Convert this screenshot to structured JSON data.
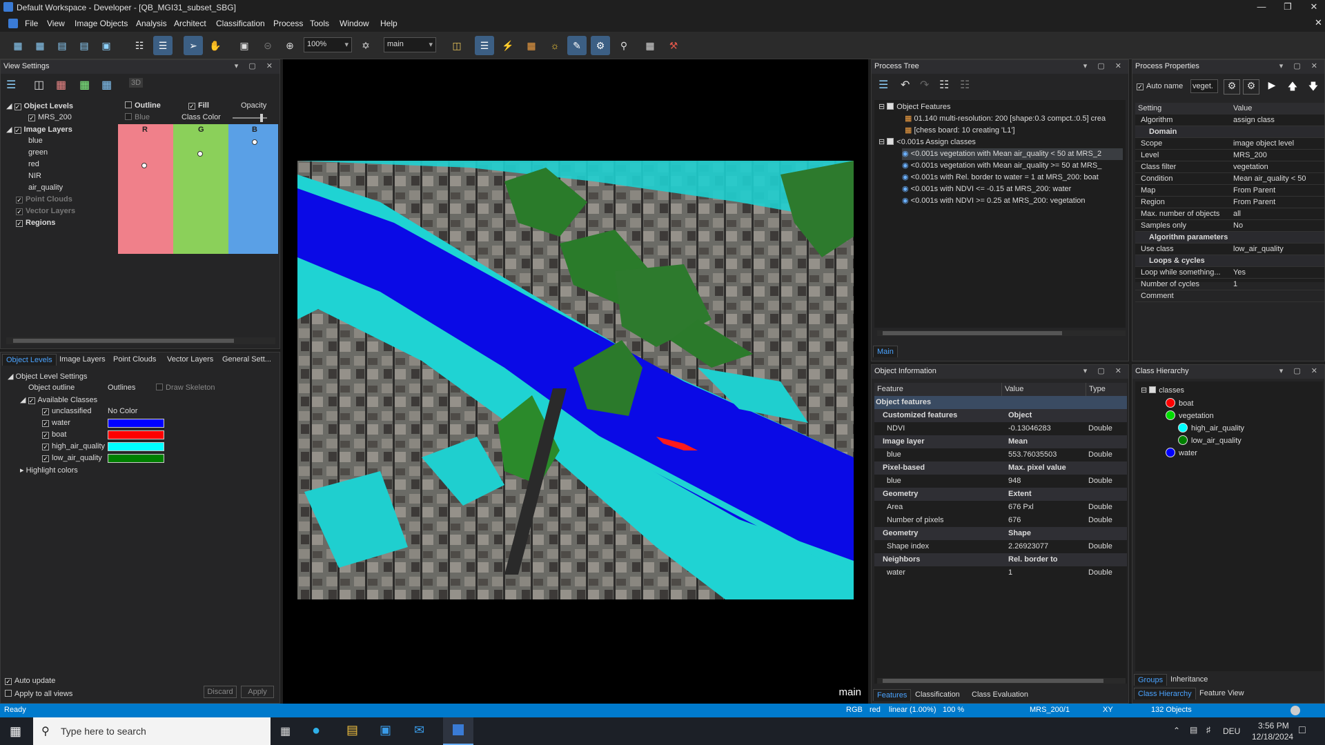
{
  "window": {
    "title": "Default Workspace - Developer - [QB_MGI31_subset_SBG]"
  },
  "menu": [
    "File",
    "View",
    "Image Objects",
    "Analysis",
    "Architect",
    "Classification",
    "Process",
    "Tools",
    "Window",
    "Help"
  ],
  "toolbar": {
    "zoom": "100%",
    "view": "main"
  },
  "view_settings": {
    "title": "View Settings",
    "rows": {
      "object_levels": "Object Levels",
      "mrs": "MRS_200",
      "image_layers": "Image Layers",
      "blue": "blue",
      "green": "green",
      "red": "red",
      "nir": "NIR",
      "air": "air_quality",
      "point_clouds": "Point Clouds",
      "vector_layers": "Vector Layers",
      "regions": "Regions"
    },
    "cols": {
      "outline": "Outline",
      "fill": "Fill",
      "opacity": "Opacity",
      "blue_lbl": "Blue",
      "class_color": "Class Color",
      "r": "R",
      "g": "G",
      "b": "B"
    },
    "mode_3d": "3D"
  },
  "lower_left": {
    "tabs": [
      "Object Levels",
      "Image Layers",
      "Point Clouds",
      "Vector Layers",
      "General Sett..."
    ],
    "settings_title": "Object Level Settings",
    "object_outline": "Object outline",
    "outlines": "Outlines",
    "draw_skeleton": "Draw Skeleton",
    "available_classes": "Available Classes",
    "classes": [
      {
        "name": "unclassified",
        "value": "No Color",
        "color": ""
      },
      {
        "name": "water",
        "color": "#0000ff"
      },
      {
        "name": "boat",
        "color": "#ff0000"
      },
      {
        "name": "high_air_quality",
        "color": "#00ffff"
      },
      {
        "name": "low_air_quality",
        "color": "#008000"
      }
    ],
    "highlight": "Highlight colors",
    "auto_update": "Auto update",
    "apply_all": "Apply to all views",
    "discard": "Discard",
    "apply": "Apply"
  },
  "map": {
    "label": "main"
  },
  "process_tree": {
    "title": "Process Tree",
    "tab": "Main",
    "items": [
      "Object Features",
      "01.140   multi-resolution: 200 [shape:0.3 compct.:0.5] crea",
      "[chess board: 10 creating 'L1']",
      "<0.001s   Assign classes",
      "<0.001s   vegetation with Mean air_quality < 50  at MRS_2",
      "<0.001s   vegetation with Mean air_quality >= 50  at MRS_",
      "<0.001s   with Rel. border to water = 1  at MRS_200: boat",
      "<0.001s   with NDVI <= -0.15  at MRS_200: water",
      "<0.001s   with NDVI >= 0.25  at MRS_200: vegetation"
    ]
  },
  "process_properties": {
    "title": "Process Properties",
    "auto_name": "Auto name",
    "name_value": "veget.",
    "headers": [
      "Setting",
      "Value"
    ],
    "rows": [
      [
        "Algorithm",
        "assign class",
        ""
      ],
      [
        "Domain",
        "",
        "sec"
      ],
      [
        "Scope",
        "image object level",
        ""
      ],
      [
        "Level",
        "MRS_200",
        ""
      ],
      [
        "Class filter",
        "vegetation",
        ""
      ],
      [
        "Condition",
        "Mean air_quality < 50",
        ""
      ],
      [
        "Map",
        "From Parent",
        ""
      ],
      [
        "Region",
        "From Parent",
        ""
      ],
      [
        "Max. number of objects",
        "all",
        ""
      ],
      [
        "Samples only",
        "No",
        ""
      ],
      [
        "Algorithm parameters",
        "",
        "sec"
      ],
      [
        "Use class",
        "low_air_quality",
        ""
      ],
      [
        "Loops & cycles",
        "",
        "sec"
      ],
      [
        "Loop while something...",
        "Yes",
        ""
      ],
      [
        "Number of cycles",
        "1",
        ""
      ],
      [
        "Comment",
        "",
        ""
      ]
    ]
  },
  "object_info": {
    "title": "Object Information",
    "headers": [
      "Feature",
      "Value",
      "Type"
    ],
    "rows": [
      [
        "Object features",
        "",
        "",
        "top"
      ],
      [
        "Customized features",
        "Object",
        "",
        "sec"
      ],
      [
        "NDVI",
        "-0.13046283",
        "Double",
        ""
      ],
      [
        "Image layer",
        "Mean",
        "",
        "sec"
      ],
      [
        "blue",
        "553.76035503",
        "Double",
        ""
      ],
      [
        "Pixel-based",
        "Max. pixel value",
        "",
        "sec"
      ],
      [
        "blue",
        "948",
        "Double",
        ""
      ],
      [
        "Geometry",
        "Extent",
        "",
        "sec"
      ],
      [
        "Area",
        "676 Pxl",
        "Double",
        ""
      ],
      [
        "Number of pixels",
        "676",
        "Double",
        ""
      ],
      [
        "Geometry",
        "Shape",
        "",
        "sec"
      ],
      [
        "Shape index",
        "2.26923077",
        "Double",
        ""
      ],
      [
        "Neighbors",
        "Rel. border to",
        "",
        "sec"
      ],
      [
        "water",
        "1",
        "Double",
        ""
      ]
    ],
    "tabs": [
      "Features",
      "Classification",
      "Class Evaluation"
    ]
  },
  "class_hierarchy": {
    "title": "Class Hierarchy",
    "root": "classes",
    "items": [
      {
        "name": "boat",
        "color": "#ff0000",
        "indent": 1
      },
      {
        "name": "vegetation",
        "color": "#00dd00",
        "indent": 1
      },
      {
        "name": "high_air_quality",
        "color": "#00ffff",
        "indent": 2
      },
      {
        "name": "low_air_quality",
        "color": "#008000",
        "indent": 2
      },
      {
        "name": "water",
        "color": "#0000ff",
        "indent": 1
      }
    ],
    "tabs": [
      "Groups",
      "Inheritance"
    ],
    "bottom_tabs": [
      "Class Hierarchy",
      "Feature View"
    ]
  },
  "status": {
    "ready": "Ready",
    "rgb": "RGB",
    "red": "red",
    "linear": "linear (1.00%)",
    "zoom": "100 %",
    "level": "MRS_200/1",
    "xy": "XY",
    "objects": "132 Objects"
  },
  "taskbar": {
    "search": "Type here to search",
    "time": "3:56 PM",
    "date": "12/18/2024",
    "lang": "DEU"
  }
}
